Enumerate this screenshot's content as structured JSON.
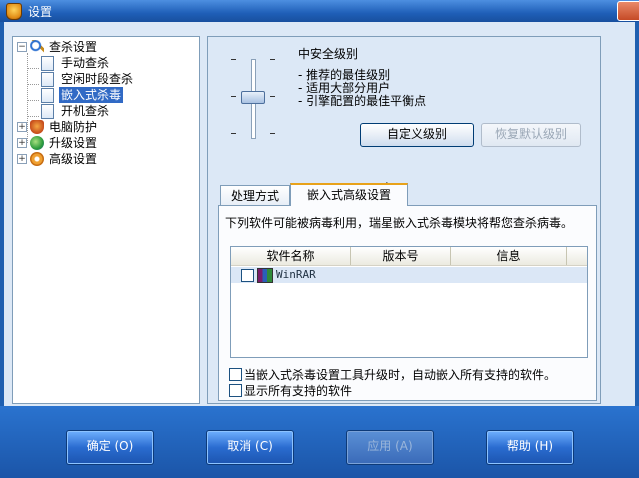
{
  "window": {
    "title": "设置"
  },
  "tree": {
    "items": [
      {
        "label": "查杀设置",
        "icon": "magnifier-icon",
        "level": 0,
        "expander": "-"
      },
      {
        "label": "手动查杀",
        "icon": "page-icon",
        "level": 1
      },
      {
        "label": "空闲时段查杀",
        "icon": "page-icon",
        "level": 1
      },
      {
        "label": "嵌入式杀毒",
        "icon": "page-icon",
        "level": 1,
        "selected": true
      },
      {
        "label": "开机查杀",
        "icon": "page-icon",
        "level": 1
      },
      {
        "label": "电脑防护",
        "icon": "shield-icon",
        "level": 0,
        "expander": "+"
      },
      {
        "label": "升级设置",
        "icon": "globe-icon",
        "level": 0,
        "expander": "+"
      },
      {
        "label": "高级设置",
        "icon": "gear-icon",
        "level": 0,
        "expander": "+"
      }
    ]
  },
  "security_level": {
    "title": "中安全级别",
    "lines": [
      "- 推荐的最佳级别",
      "- 适用大部分用户",
      "- 引擎配置的最佳平衡点"
    ],
    "custom_button": "自定义级别",
    "restore_button": "恢复默认级别"
  },
  "tabs": [
    {
      "label": "处理方式"
    },
    {
      "label": "嵌入式高级设置",
      "active": true
    }
  ],
  "embedded": {
    "intro": "下列软件可能被病毒利用，瑞星嵌入式杀毒模块将帮您查杀病毒。",
    "columns": [
      "软件名称",
      "版本号",
      "信息"
    ],
    "rows": [
      {
        "name": "WinRAR",
        "checked": false
      }
    ],
    "option_auto": "当嵌入式杀毒设置工具升级时，自动嵌入所有支持的软件。",
    "option_show_all": "显示所有支持的软件"
  },
  "footer": {
    "ok": "确定 (O)",
    "cancel": "取消 (C)",
    "apply": "应用 (A)",
    "help": "帮助 (H)"
  },
  "colors": {
    "titlebar": "#1f5fb8",
    "client_bg": "#dce8f6",
    "selection": "#316ac5",
    "footer_bg": "#1b55a8"
  }
}
